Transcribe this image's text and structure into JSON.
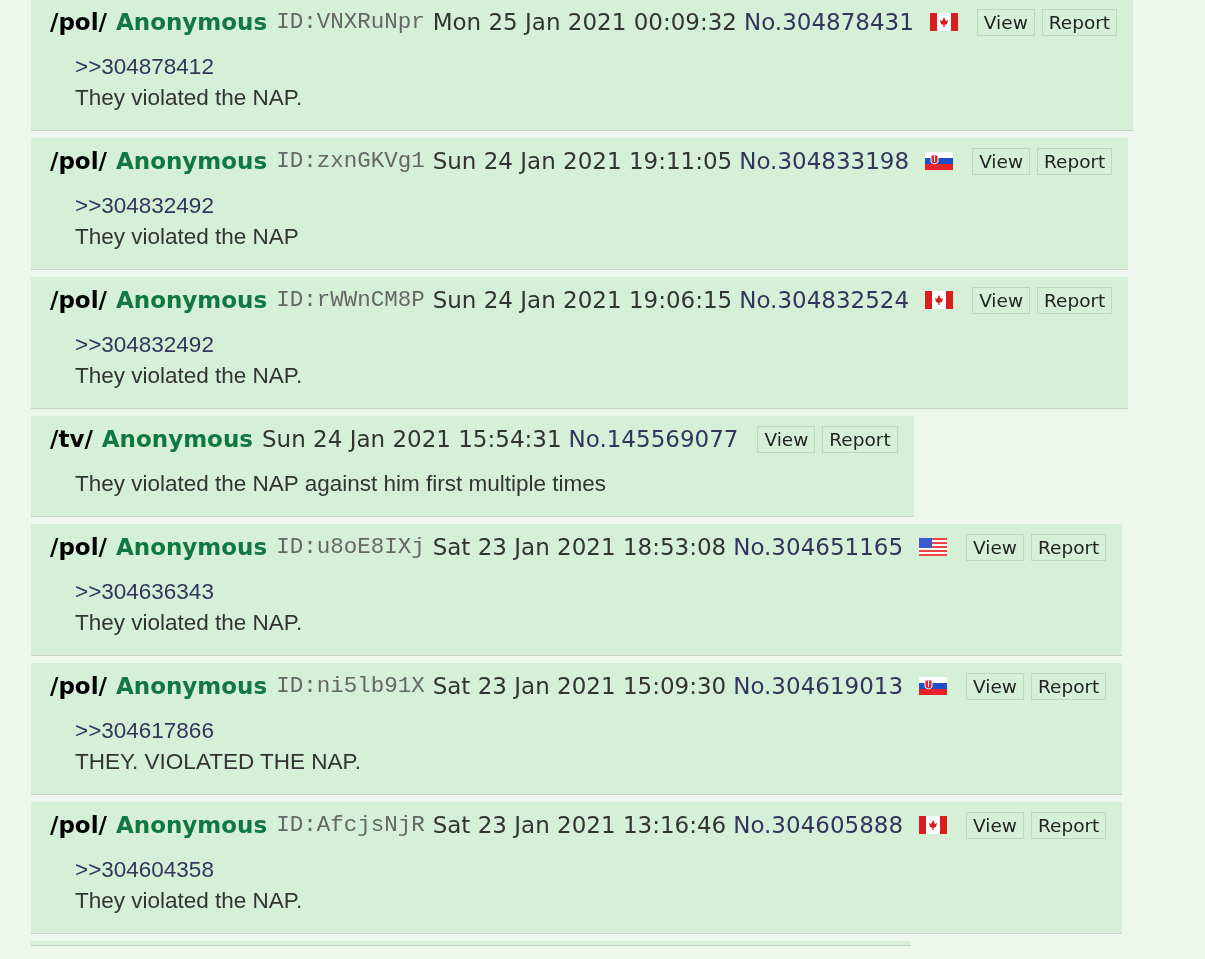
{
  "posts": [
    {
      "kind": "post",
      "board": "/pol/",
      "name": "Anonymous",
      "id": "ID:VNXRuNpr",
      "date": "Mon 25 Jan 2021 00:09:32",
      "number": "No.304878431",
      "flag": {
        "kind": "ca"
      },
      "buttons": [
        "View",
        "Report"
      ],
      "quote": ">>304878412",
      "text": "They violated the NAP."
    },
    {
      "kind": "post",
      "board": "/pol/",
      "name": "Anonymous",
      "id": "ID:zxnGKVg1",
      "date": "Sun 24 Jan 2021 19:11:05",
      "number": "No.304833198",
      "flag": {
        "kind": "sk"
      },
      "buttons": [
        "View",
        "Report"
      ],
      "quote": ">>304832492",
      "text": "They violated the NAP"
    },
    {
      "kind": "post",
      "board": "/pol/",
      "name": "Anonymous",
      "id": "ID:rWWnCM8P",
      "date": "Sun 24 Jan 2021 19:06:15",
      "number": "No.304832524",
      "flag": {
        "kind": "ca"
      },
      "buttons": [
        "View",
        "Report"
      ],
      "quote": ">>304832492",
      "text": "They violated the NAP."
    },
    {
      "kind": "post",
      "board": "/tv/",
      "name": "Anonymous",
      "date": "Sun 24 Jan 2021 15:54:31",
      "number": "No.145569077",
      "buttons": [
        "View",
        "Report"
      ],
      "text": "They violated the NAP against him first multiple times"
    },
    {
      "kind": "post",
      "board": "/pol/",
      "name": "Anonymous",
      "id": "ID:u8oE8IXj",
      "date": "Sat 23 Jan 2021 18:53:08",
      "number": "No.304651165",
      "flag": {
        "kind": "us"
      },
      "buttons": [
        "View",
        "Report"
      ],
      "quote": ">>304636343",
      "text": "They violated the NAP."
    },
    {
      "kind": "post",
      "board": "/pol/",
      "name": "Anonymous",
      "id": "ID:ni5lb91X",
      "date": "Sat 23 Jan 2021 15:09:30",
      "number": "No.304619013",
      "flag": {
        "kind": "sk"
      },
      "buttons": [
        "View",
        "Report"
      ],
      "quote": ">>304617866",
      "text": "THEY. VIOLATED THE NAP."
    },
    {
      "kind": "post",
      "board": "/pol/",
      "name": "Anonymous",
      "id": "ID:AfcjsNjR",
      "date": "Sat 23 Jan 2021 13:16:46",
      "number": "No.304605888",
      "flag": {
        "kind": "ca"
      },
      "buttons": [
        "View",
        "Report"
      ],
      "quote": ">>304604358",
      "text": "They violated the NAP."
    },
    {
      "kind": "cut"
    }
  ]
}
